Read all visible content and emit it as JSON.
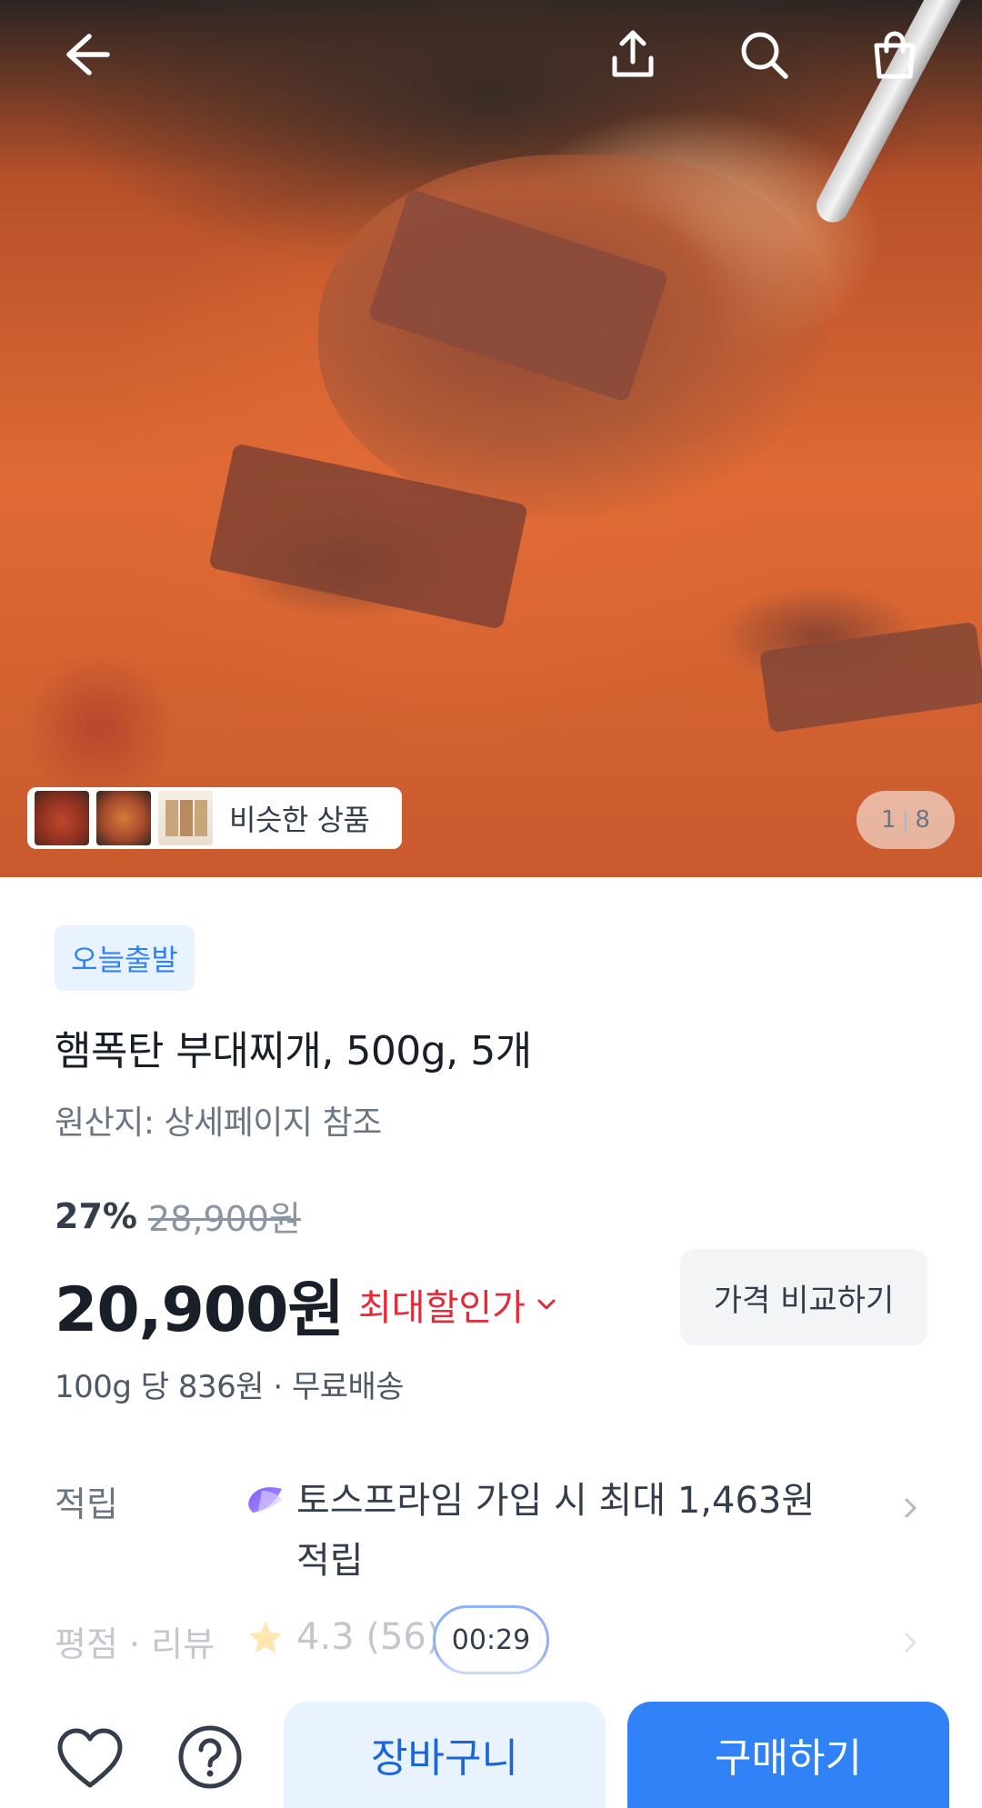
{
  "gallery": {
    "similar_label": "비슷한 상품",
    "pager_current": "1",
    "pager_total": "8"
  },
  "topbar": {
    "icons": [
      "back-arrow-icon",
      "share-icon",
      "search-icon",
      "shopping-bag-icon"
    ]
  },
  "product": {
    "badge": "오늘출발",
    "title": "햄폭탄 부대찌개, 500g, 5개",
    "origin": "원산지: 상세페이지 참조"
  },
  "pricing": {
    "discount_percent": "27%",
    "original_price": "28,900원",
    "price": "20,900원",
    "max_discount_label": "최대할인가",
    "compare_button": "가격 비교하기",
    "unit_price": "100g 당 836원 · 무료배송"
  },
  "points": {
    "label": "적립",
    "text": "토스프라임 가입 시 최대 1,463원 적립"
  },
  "rating": {
    "label": "평점 · 리뷰",
    "score": "4.3",
    "count": "(56)"
  },
  "timer": "00:29",
  "bottom_bar": {
    "cart": "장바구니",
    "buy": "구매하기"
  },
  "colors": {
    "accent_blue": "#3182f6",
    "badge_bg": "#e8f3ff",
    "discount_red": "#e42939"
  }
}
